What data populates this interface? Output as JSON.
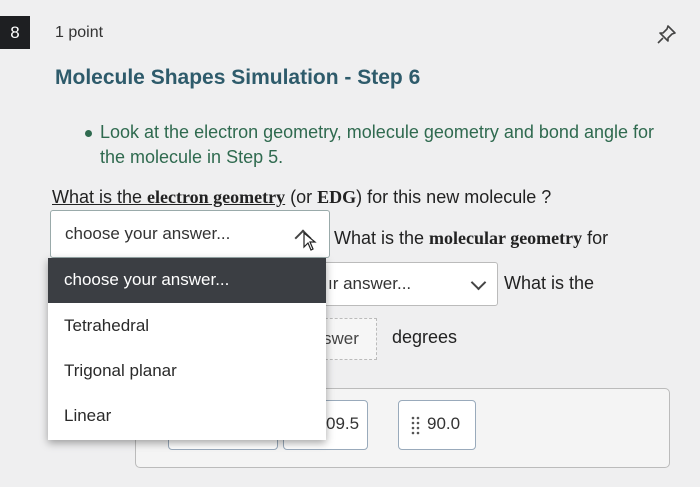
{
  "question": {
    "number": "8",
    "points": "1 point",
    "title": "Molecule Shapes Simulation - Step 6",
    "bullet": "Look at the electron geometry, molecule geometry and bond angle for the molecule in Step 5.",
    "q1_prefix": "What is the ",
    "q1_bold": "electron geometry",
    "q1_mid": " (or ",
    "q1_abbr": "EDG",
    "q1_suffix": ") for this new molecule ?",
    "q2_prefix": "What is the ",
    "q2_bold": "molecular geometry",
    "q2_suffix": " for",
    "q3_text": "What is the",
    "degrees": "degrees"
  },
  "select1": {
    "value": "choose your answer..."
  },
  "select2": {
    "visible_value": "ır answer..."
  },
  "blank": {
    "visible_value": "swer"
  },
  "dropdown": {
    "options": [
      "choose your answer...",
      "Tetrahedral",
      "Trigonal planar",
      "Linear"
    ],
    "selected_index": 0
  },
  "chips": {
    "chip2": "09.5",
    "chip3": "90.0"
  },
  "icons": {
    "pin": "pin-icon",
    "chevron_up": "chevron-up-icon",
    "chevron_down": "chevron-down-icon",
    "grip": "drag-handle-icon",
    "cursor": "mouse-cursor-icon"
  }
}
